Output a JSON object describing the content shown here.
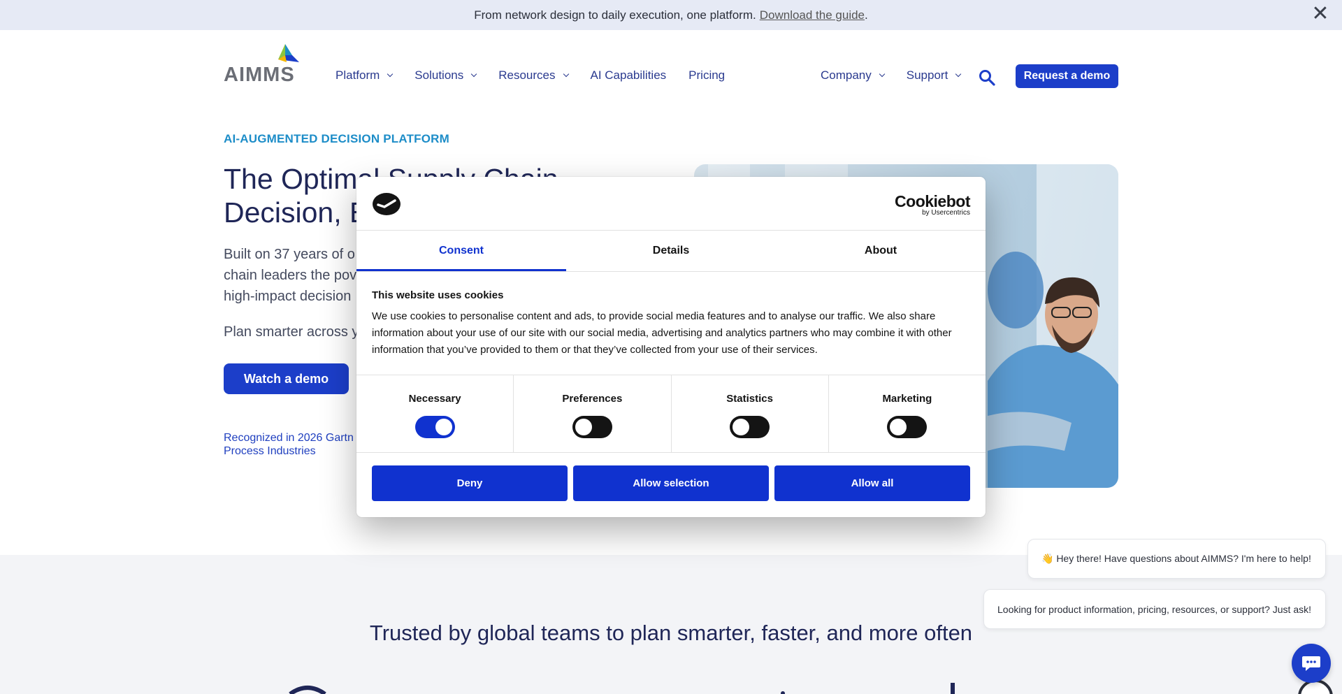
{
  "announcement": {
    "text": "From network design to daily execution, one platform.",
    "link": "Download the guide",
    "suffix": ".",
    "close_label": "✕"
  },
  "header": {
    "logo_text": "AIMMS",
    "nav_left": [
      {
        "label": "Platform",
        "has_menu": true
      },
      {
        "label": "Solutions",
        "has_menu": true
      },
      {
        "label": "Resources",
        "has_menu": true
      },
      {
        "label": "AI Capabilities",
        "has_menu": false
      },
      {
        "label": "Pricing",
        "has_menu": false
      }
    ],
    "nav_right": [
      {
        "label": "Company",
        "has_menu": true
      },
      {
        "label": "Support",
        "has_menu": true
      }
    ],
    "search_icon": "search-icon",
    "cta_label": "Request a demo"
  },
  "hero": {
    "eyebrow": "AI-AUGMENTED DECISION PLATFORM",
    "title_line1": "The Optimal Supply Chain",
    "title_line2": "Decision, E",
    "body_line1": "Built on 37 years of o",
    "body_line2": "chain leaders the pov",
    "body_line3": "high-impact decision",
    "body2": "Plan smarter across y",
    "watch_label": "Watch a demo",
    "recognized_line1": "Recognized in 2026 Gartn",
    "recognized_line2": "Process Industries"
  },
  "cookie_dialog": {
    "brand": "Cookiebot",
    "brand_sub": "by Usercentrics",
    "tabs": [
      {
        "label": "Consent",
        "active": true
      },
      {
        "label": "Details",
        "active": false
      },
      {
        "label": "About",
        "active": false
      }
    ],
    "heading": "This website uses cookies",
    "text": "We use cookies to personalise content and ads, to provide social media features and to analyse our traffic. We also share information about your use of our site with our social media, advertising and analytics partners who may combine it with other information that you’ve provided to them or that they’ve collected from your use of their services.",
    "toggles": [
      {
        "label": "Necessary",
        "on": true
      },
      {
        "label": "Preferences",
        "on": false
      },
      {
        "label": "Statistics",
        "on": false
      },
      {
        "label": "Marketing",
        "on": false
      }
    ],
    "buttons": {
      "deny": "Deny",
      "allow_selection": "Allow selection",
      "allow_all": "Allow all"
    }
  },
  "trusted": {
    "heading": "Trusted by global teams to plan smarter, faster, and more often"
  },
  "chat": {
    "bubble1": "👋 Hey there! Have questions about AIMMS? I'm here to help!",
    "bubble2": "Looking for product information, pricing, resources, or support? Just ask!"
  },
  "colors": {
    "brand_blue": "#1c3ec9",
    "cookiebot_blue": "#1032cf",
    "eyebrow": "#1d8dc8",
    "announcement_bg": "#e6eaf5"
  }
}
